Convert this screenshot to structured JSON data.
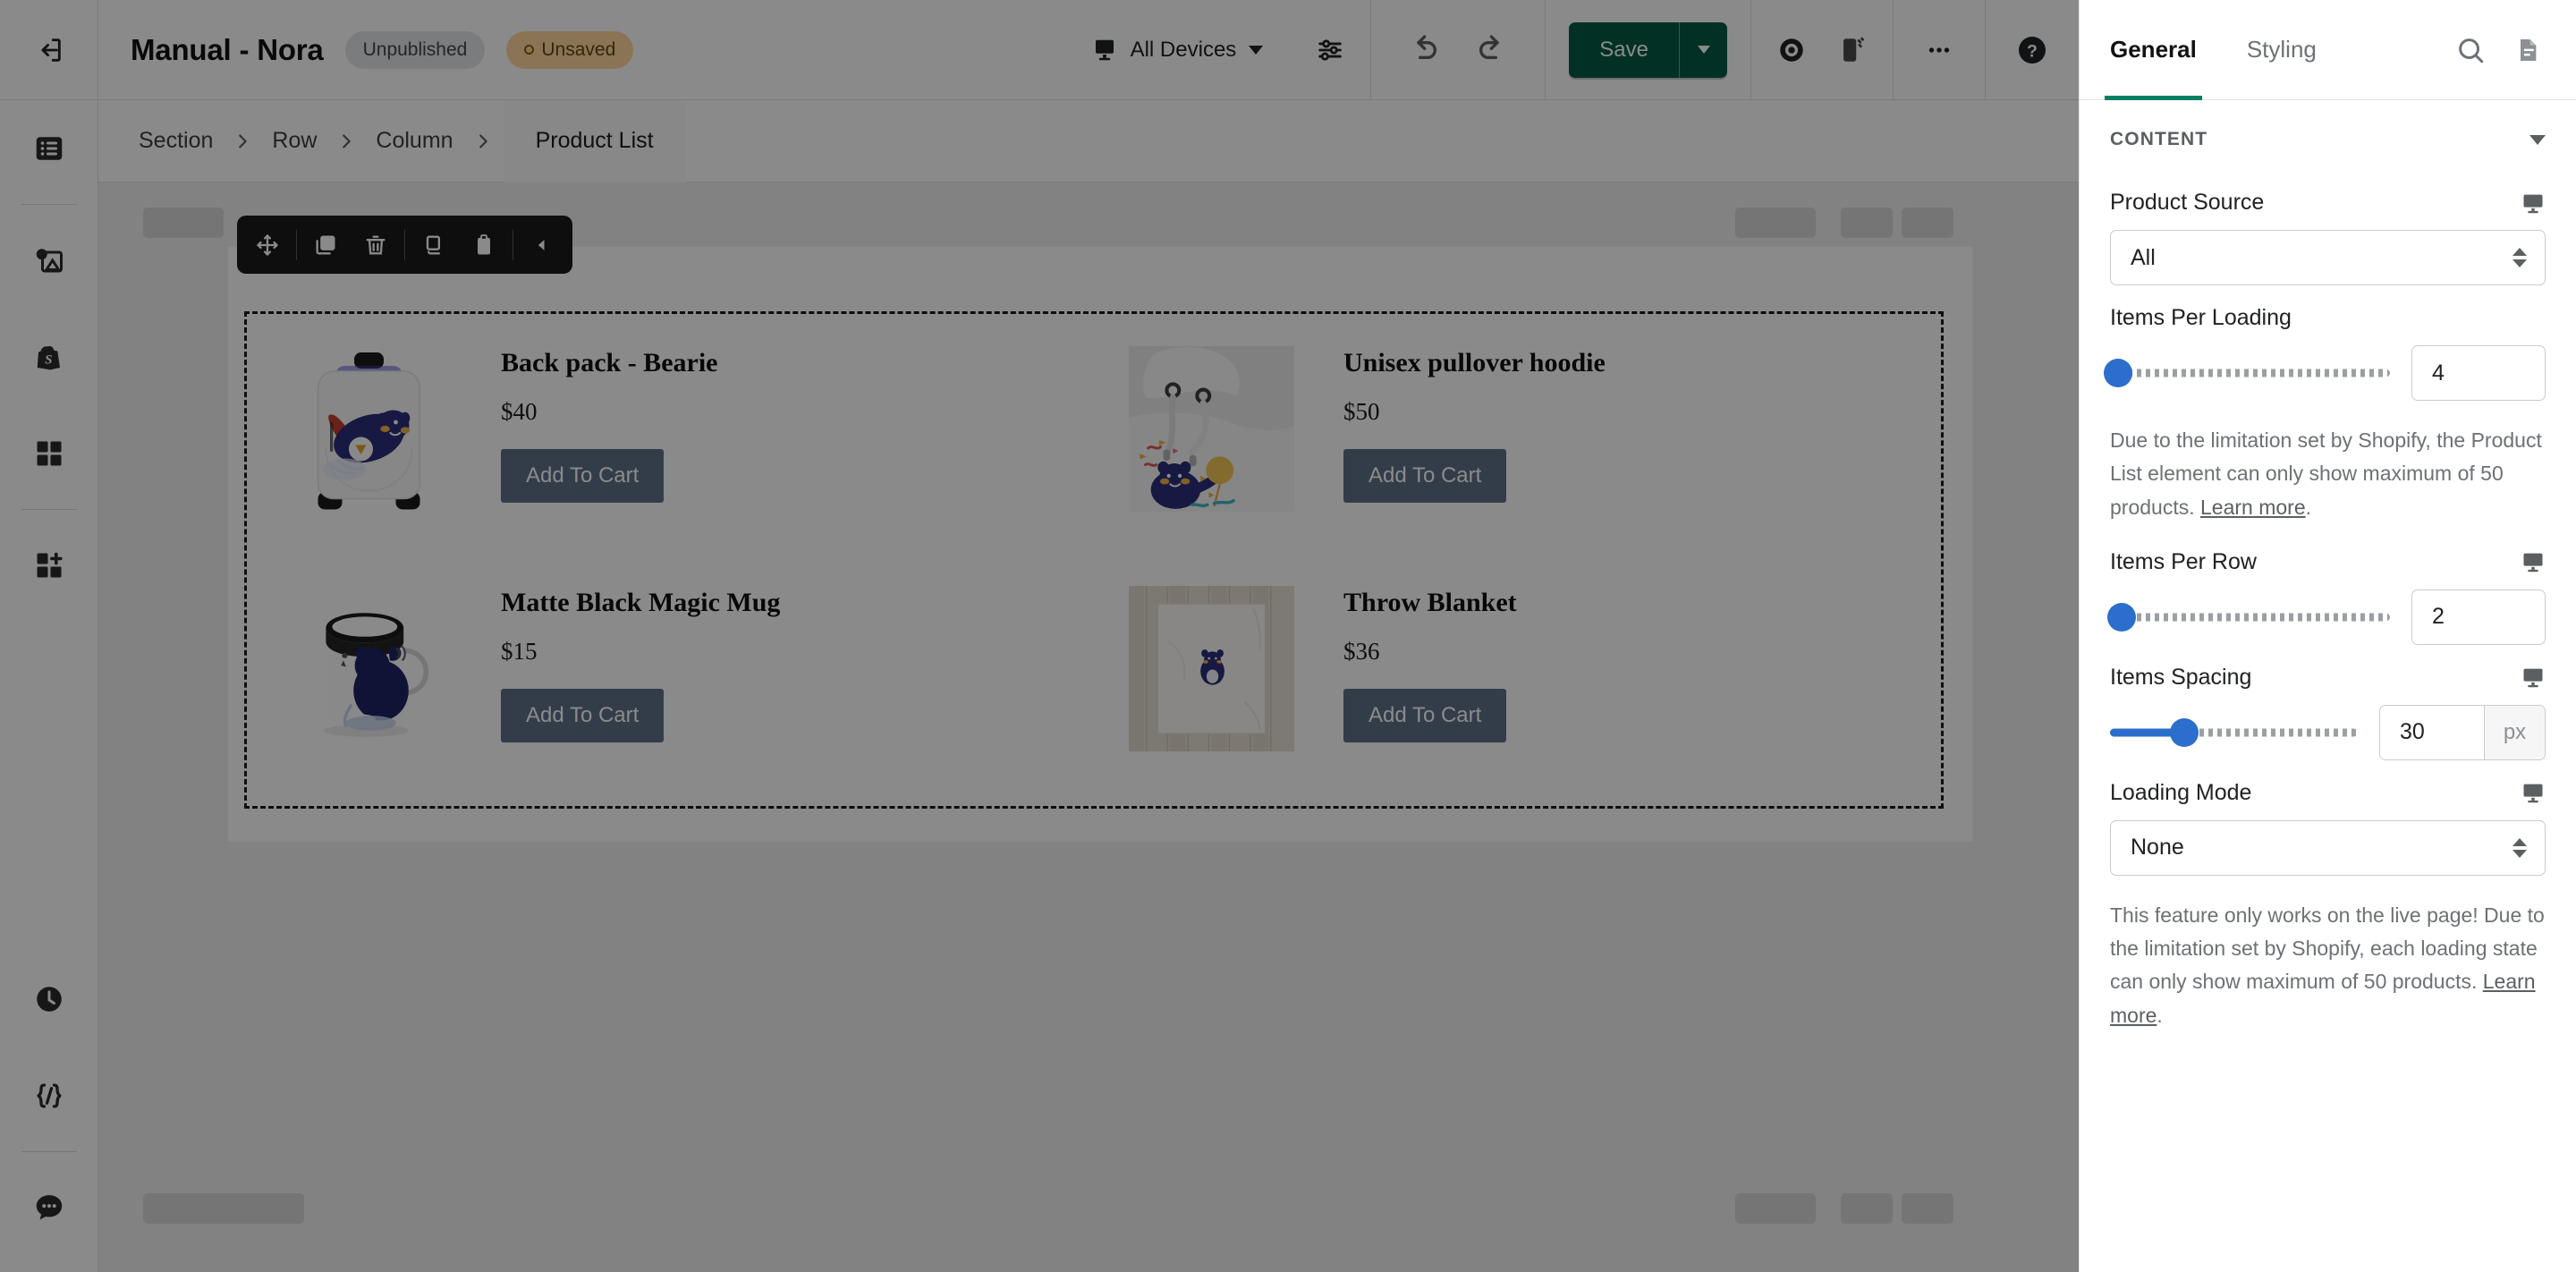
{
  "topbar": {
    "back_icon": "exit-icon",
    "title": "Manual - Nora",
    "status_unpublished": "Unpublished",
    "status_unsaved": "Unsaved",
    "devices_label": "All Devices",
    "devices_icon": "desktop-icon",
    "preferences_icon": "sliders-icon",
    "undo_icon": "undo-icon",
    "redo_icon": "redo-icon",
    "save_label": "Save",
    "save_dropdown_icon": "chevron-down-icon",
    "preview_icon": "eye-icon",
    "fullscreen_icon": "device-preview-icon",
    "more_icon": "ellipsis-icon",
    "help_icon": "question-mark-icon",
    "save_color": "#005c44"
  },
  "left_rail": {
    "items": [
      {
        "name": "layers-icon"
      },
      {
        "name": "media-image-icon"
      },
      {
        "name": "shopify-bag-icon"
      },
      {
        "name": "elements-grid-icon"
      },
      {
        "name": "add-element-icon"
      }
    ],
    "bottom_items": [
      {
        "name": "history-clock-icon"
      },
      {
        "name": "code-braces-icon"
      },
      {
        "name": "chat-bubble-icon"
      }
    ]
  },
  "breadcrumb": {
    "items": [
      "Section",
      "Row",
      "Column"
    ],
    "active": "Product List",
    "separator_icon": "chevron-right-icon"
  },
  "element_toolbar": {
    "buttons": [
      {
        "name": "move-icon"
      },
      {
        "name": "duplicate-icon"
      },
      {
        "name": "delete-trash-icon"
      },
      {
        "name": "copy-style-icon"
      },
      {
        "name": "paste-style-icon"
      },
      {
        "name": "collapse-left-icon"
      }
    ]
  },
  "canvas": {
    "products": [
      {
        "title": "Back pack - Bearie",
        "price": "$40",
        "cta": "Add To Cart",
        "image": "backpack-bearie-image"
      },
      {
        "title": "Unisex pullover hoodie",
        "price": "$50",
        "cta": "Add To Cart",
        "image": "hoodie-bear-image"
      },
      {
        "title": "Matte Black Magic Mug",
        "price": "$15",
        "cta": "Add To Cart",
        "image": "magic-mug-image"
      },
      {
        "title": "Throw Blanket",
        "price": "$36",
        "cta": "Add To Cart",
        "image": "throw-blanket-image"
      }
    ],
    "cta_color": "#5f7189"
  },
  "right_panel": {
    "tabs": [
      {
        "label": "General",
        "active": true
      },
      {
        "label": "Styling",
        "active": false
      }
    ],
    "accent_color": "#008060",
    "search_icon": "search-icon",
    "notes_icon": "document-icon",
    "section_title": "CONTENT",
    "section_toggle_icon": "chevron-down-icon",
    "fields": {
      "product_source": {
        "label": "Product Source",
        "value": "All",
        "device_icon": "desktop-icon",
        "stepper_icon": "updown-arrows-icon"
      },
      "items_per_loading": {
        "label": "Items Per Loading",
        "value": "4",
        "slider_percent": 3,
        "slider_filled": false,
        "device_icon": "desktop-icon",
        "help_text_before": "Due to the limitation set by Shopify, the Product List element can only show maximum of 50 products. ",
        "help_link": "Learn more",
        "help_text_after": "."
      },
      "items_per_row": {
        "label": "Items Per Row",
        "value": "2",
        "slider_percent": 4,
        "slider_filled": true,
        "device_icon": "desktop-icon"
      },
      "items_spacing": {
        "label": "Items Spacing",
        "value": "30",
        "unit": "px",
        "slider_percent": 30,
        "slider_filled": true,
        "device_icon": "desktop-icon"
      },
      "loading_mode": {
        "label": "Loading Mode",
        "value": "None",
        "device_icon": "desktop-icon",
        "stepper_icon": "updown-arrows-icon",
        "help_text_before": "This feature only works on the live page! Due to the limitation set by Shopify, each loading state can only show maximum of 50 products. ",
        "help_link": "Learn more",
        "help_text_after": "."
      }
    }
  }
}
